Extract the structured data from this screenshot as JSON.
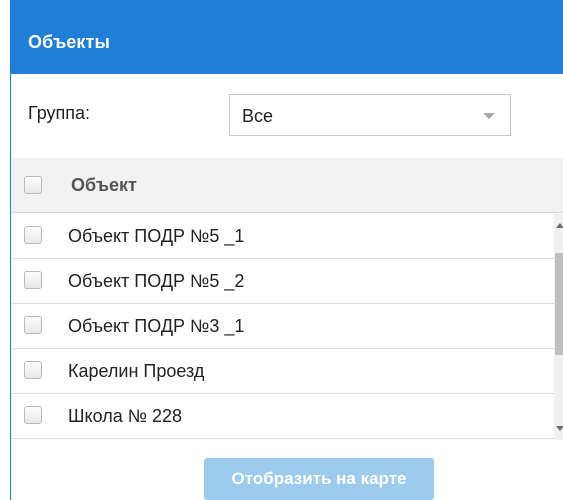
{
  "panel": {
    "title": "Объекты"
  },
  "filter": {
    "group_label": "Группа:",
    "group_value": "Все"
  },
  "table": {
    "column_header": "Объект",
    "items": [
      {
        "label": "Объект ПОДР №5 _1"
      },
      {
        "label": "Объект ПОДР №5 _2"
      },
      {
        "label": "Объект ПОДР №3 _1"
      },
      {
        "label": "Карелин Проезд"
      },
      {
        "label": "Школа № 228"
      }
    ]
  },
  "actions": {
    "show_on_map": "Отобразить на карте"
  },
  "icons": {
    "select_arrow": "chevron-down-icon",
    "scroll_up": "chevron-up-icon",
    "scroll_down": "chevron-down-icon"
  },
  "colors": {
    "header_blue": "#1f7fd6",
    "button_disabled_blue": "#9ccbee",
    "table_header_bg": "#f1f1f1"
  }
}
